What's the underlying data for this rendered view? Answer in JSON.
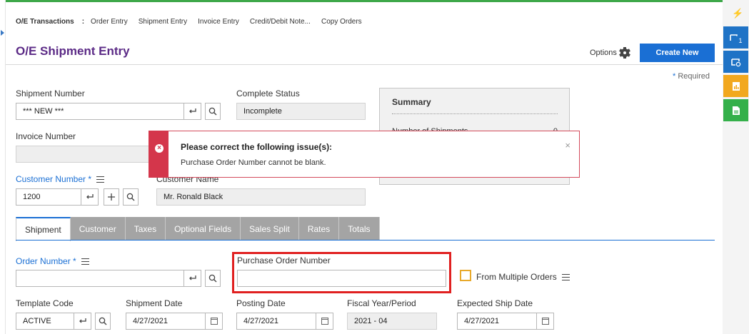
{
  "breadcrumb": {
    "root": "O/E Transactions",
    "separator": ":",
    "items": [
      "Order Entry",
      "Shipment Entry",
      "Invoice Entry",
      "Credit/Debit Note...",
      "Copy Orders"
    ]
  },
  "page_title": "O/E Shipment Entry",
  "header": {
    "options_label": "Options",
    "create_new_label": "Create New"
  },
  "required_note": "Required",
  "fields": {
    "shipment_number": {
      "label": "Shipment Number",
      "value": "*** NEW ***"
    },
    "complete_status": {
      "label": "Complete Status",
      "value": "Incomplete"
    },
    "invoice_number": {
      "label": "Invoice Number",
      "value": ""
    },
    "customer_number": {
      "label": "Customer Number",
      "value": "1200"
    },
    "customer_name": {
      "label": "Customer Name",
      "value": "Mr. Ronald Black"
    },
    "order_number": {
      "label": "Order Number",
      "value": ""
    },
    "purchase_order_number": {
      "label": "Purchase Order Number",
      "value": ""
    },
    "from_multiple_orders": {
      "label": "From Multiple Orders",
      "checked": false
    },
    "template_code": {
      "label": "Template Code",
      "value": "ACTIVE"
    },
    "shipment_date": {
      "label": "Shipment Date",
      "value": "4/27/2021"
    },
    "posting_date": {
      "label": "Posting Date",
      "value": "4/27/2021"
    },
    "fiscal_year_period": {
      "label": "Fiscal Year/Period",
      "value": "2021 - 04"
    },
    "expected_ship_date": {
      "label": "Expected Ship Date",
      "value": "4/27/2021"
    }
  },
  "summary": {
    "title": "Summary",
    "row_label": "Number of Shipments",
    "row_value": "0"
  },
  "alert": {
    "title": "Please correct the following issue(s):",
    "message": "Purchase Order Number cannot be blank."
  },
  "tabs": [
    "Shipment",
    "Customer",
    "Taxes",
    "Optional Fields",
    "Sales Split",
    "Rates",
    "Totals"
  ],
  "active_tab": "Shipment",
  "side_toolbar": {
    "notification_badge": "1",
    "colors": {
      "blue": "#1f73c6",
      "orange": "#f2a81e",
      "green": "#34b04a"
    }
  },
  "colors": {
    "title": "#5b2a86",
    "accent": "#1a6fd4",
    "error": "#d4364b",
    "highlight": "#e02020"
  }
}
